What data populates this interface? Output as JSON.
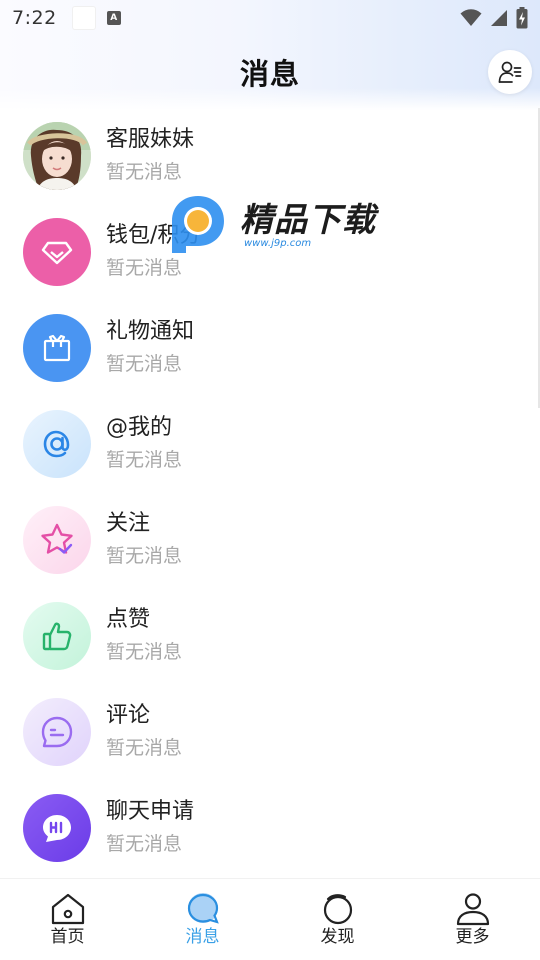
{
  "status_bar": {
    "time": "7:22",
    "a_icon_letter": "A"
  },
  "header": {
    "title": "消息"
  },
  "watermark": {
    "brand": "精品下载",
    "url": "www.j9p.com"
  },
  "messages": [
    {
      "title": "客服妹妹",
      "subtitle": "暂无消息",
      "icon": "service-girl-avatar"
    },
    {
      "title": "钱包/积分",
      "subtitle": "暂无消息",
      "icon": "diamond-icon",
      "color": "#ec5fa8"
    },
    {
      "title": "礼物通知",
      "subtitle": "暂无消息",
      "icon": "gift-icon",
      "color": "#4a95f2"
    },
    {
      "title": "@我的",
      "subtitle": "暂无消息",
      "icon": "at-icon",
      "color": "#d7ecfc"
    },
    {
      "title": "关注",
      "subtitle": "暂无消息",
      "icon": "star-icon",
      "color": "#fde3f1"
    },
    {
      "title": "点赞",
      "subtitle": "暂无消息",
      "icon": "thumbs-up-icon",
      "color": "#d6f8e6"
    },
    {
      "title": "评论",
      "subtitle": "暂无消息",
      "icon": "comment-icon",
      "color": "#ece4fb"
    },
    {
      "title": "聊天申请",
      "subtitle": "暂无消息",
      "icon": "hi-chat-icon",
      "color": "#7b4ef0"
    }
  ],
  "tabs": [
    {
      "label": "首页",
      "icon": "home-icon",
      "active": false
    },
    {
      "label": "消息",
      "icon": "message-icon",
      "active": true
    },
    {
      "label": "发现",
      "icon": "discover-icon",
      "active": false
    },
    {
      "label": "更多",
      "icon": "profile-icon",
      "active": false
    }
  ],
  "colors": {
    "accent": "#3aa0e6"
  }
}
